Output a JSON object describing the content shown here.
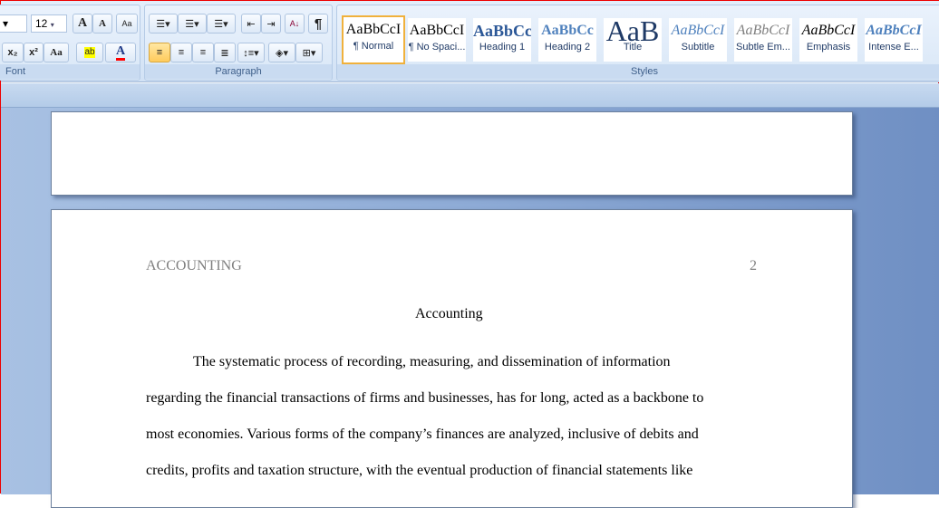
{
  "ribbon": {
    "font": {
      "label": "Font",
      "size": "12",
      "grow": "A",
      "shrink": "A",
      "clear": "Aa",
      "subscript": "x₂",
      "superscript": "x²",
      "case": "Aa",
      "highlight": "ab",
      "font_color": "A",
      "highlight_color": "#ffff00",
      "font_color_value": "#ff0000"
    },
    "paragraph": {
      "label": "Paragraph",
      "pilcrow": "¶",
      "sort": "A↓"
    },
    "styles": {
      "label": "Styles",
      "items": [
        {
          "preview": "AaBbCcI",
          "name": "¶ Normal",
          "active": true
        },
        {
          "preview": "AaBbCcI",
          "name": "¶ No Spaci..."
        },
        {
          "preview": "AaBbCc",
          "name": "Heading 1"
        },
        {
          "preview": "AaBbCc",
          "name": "Heading 2"
        },
        {
          "preview": "AaB",
          "name": "Title"
        },
        {
          "preview": "AaBbCcI",
          "name": "Subtitle"
        },
        {
          "preview": "AaBbCcI",
          "name": "Subtle Em..."
        },
        {
          "preview": "AaBbCcI",
          "name": "Emphasis"
        },
        {
          "preview": "AaBbCcI",
          "name": "Intense E..."
        }
      ]
    }
  },
  "document": {
    "header_left": "ACCOUNTING",
    "page_number": "2",
    "title": "Accounting",
    "lines": [
      "The systematic process of recording, measuring, and dissemination of information",
      "regarding the financial transactions of firms and businesses, has for long, acted as a backbone to",
      "most economies. Various forms of the company’s finances are analyzed, inclusive of debits and",
      "credits, profits and taxation structure, with the eventual production of financial statements like"
    ]
  }
}
